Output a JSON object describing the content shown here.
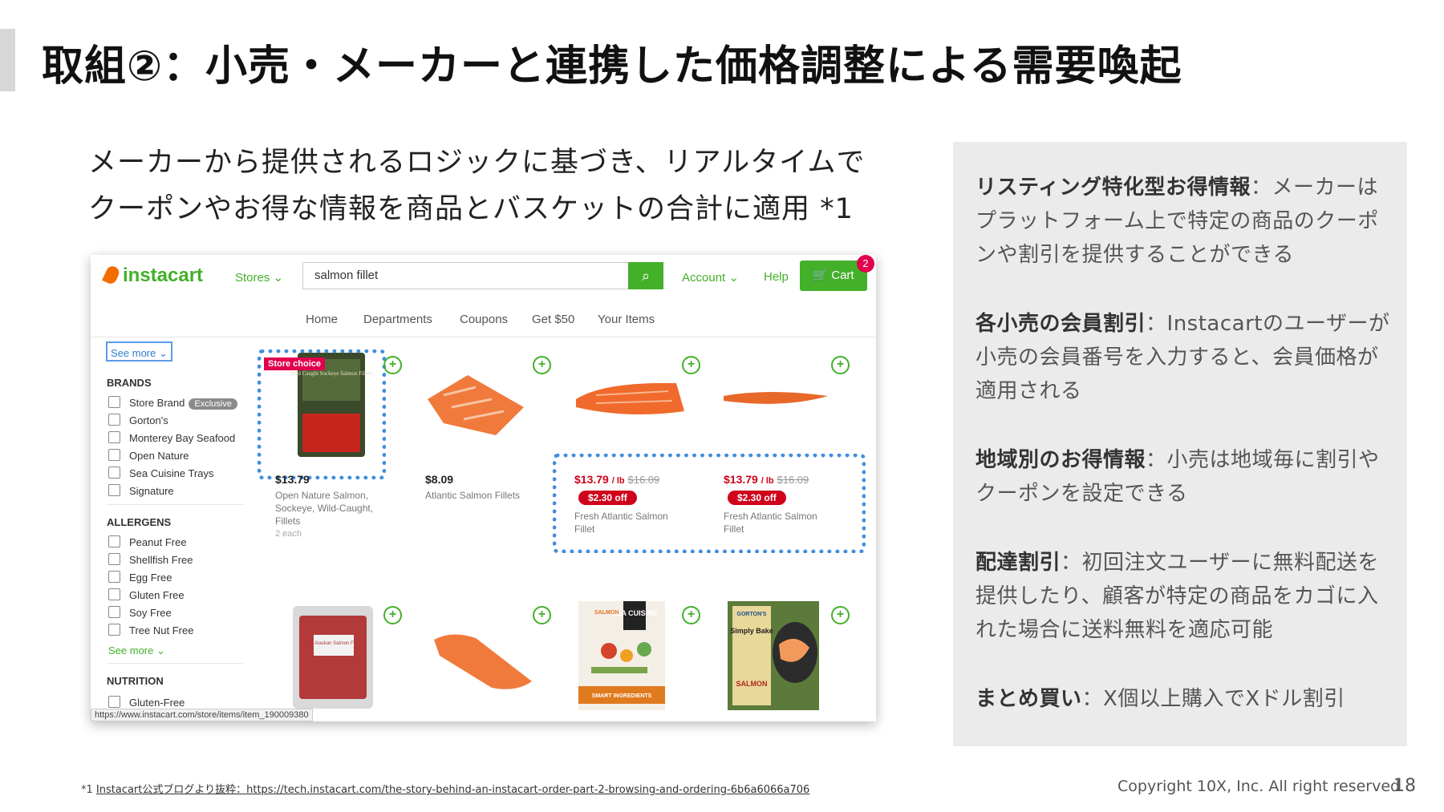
{
  "slide": {
    "title": "取組②：小売・メーカーと連携した価格調整による需要喚起",
    "subtitle_line1": "メーカーから提供されるロジックに基づき、リアルタイムで",
    "subtitle_line2": "クーポンやお得な情報を商品とバスケットの合計に適用 *1",
    "page_number": "18",
    "copyright": "Copyright 10X, Inc. All right reserved",
    "footnote_prefix": "*1 ",
    "footnote_link": "Instacart公式ブログより抜粋：https://tech.instacart.com/the-story-behind-an-instacart-order-part-2-browsing-and-ordering-6b6a6066a706"
  },
  "panel": {
    "items": [
      {
        "head": "リスティング特化型お得情報",
        "sep": "：",
        "body": "メーカーはプラットフォーム上で特定の商品のクーポンや割引を提供することができる"
      },
      {
        "head": "各小売の会員割引",
        "sep": "：",
        "body": "Instacartのユーザーが小売の会員番号を入力すると、会員価格が適用される"
      },
      {
        "head": "地域別のお得情報",
        "sep": "：",
        "body": "小売は地域毎に割引やクーポンを設定できる"
      },
      {
        "head": "配達割引",
        "sep": "：",
        "body": "初回注文ユーザーに無料配送を提供したり、顧客が特定の商品をカゴに入れた場合に送料無料を適応可能"
      },
      {
        "head": "まとめ買い",
        "sep": "：",
        "body": "X個以上購入でXドル割引"
      }
    ]
  },
  "screenshot": {
    "logo": "instacart",
    "stores": "Stores ⌄",
    "search_value": "salmon fillet",
    "account": "Account ⌄",
    "help": "Help",
    "cart_label": "Cart",
    "cart_count": "2",
    "nav": [
      "Home",
      "Departments",
      "Coupons",
      "Get $50",
      "Your Items"
    ],
    "sidebar": {
      "see_more_top": "See more ⌄",
      "brands_head": "BRANDS",
      "brands": [
        "Store Brand",
        "Gorton's",
        "Monterey Bay Seafood",
        "Open Nature",
        "Sea Cuisine Trays",
        "Signature"
      ],
      "exclusive_badge": "Exclusive",
      "allergens_head": "ALLERGENS",
      "allergens": [
        "Peanut Free",
        "Shellfish Free",
        "Egg Free",
        "Gluten Free",
        "Soy Free",
        "Tree Nut Free"
      ],
      "see_more": "See more ⌄",
      "nutrition_head": "NUTRITION",
      "nutrition": [
        "Gluten-Free"
      ]
    },
    "store_choice": "Store choice",
    "products": [
      {
        "price": "$13.79",
        "name": "Open Nature Salmon, Sockeye, Wild-Caught, Fillets",
        "sub": "2 each"
      },
      {
        "price": "$8.09",
        "name": "Atlantic Salmon Fillets"
      },
      {
        "sale": "$13.79",
        "unit": "/ lb",
        "was": "$16.09",
        "off": "$2.30 off",
        "name": "Fresh Atlantic Salmon Fillet"
      },
      {
        "sale": "$13.79",
        "unit": "/ lb",
        "was": "$16.09",
        "off": "$2.30 off",
        "name": "Fresh Atlantic Salmon Fillet"
      }
    ],
    "package_labels": {
      "p1": "Wild Caught Sockeye Salmon Fillets",
      "p5": "Wild Alaskan Salmon Fillets",
      "p7_brand": "SEA CUISINE",
      "p7_a": "SALMON",
      "p7_b": "SMART INGREDIENTS",
      "p8_brand": "GORTON'S",
      "p8_a": "Simply Bake",
      "p8_b": "SALMON"
    },
    "status_url": "https://www.instacart.com/store/items/item_190009380"
  },
  "colors": {
    "instacart_green": "#43b02a",
    "highlight_blue": "#3d8fe0",
    "sale_red": "#d0021b",
    "panel_bg": "#ebebeb"
  }
}
